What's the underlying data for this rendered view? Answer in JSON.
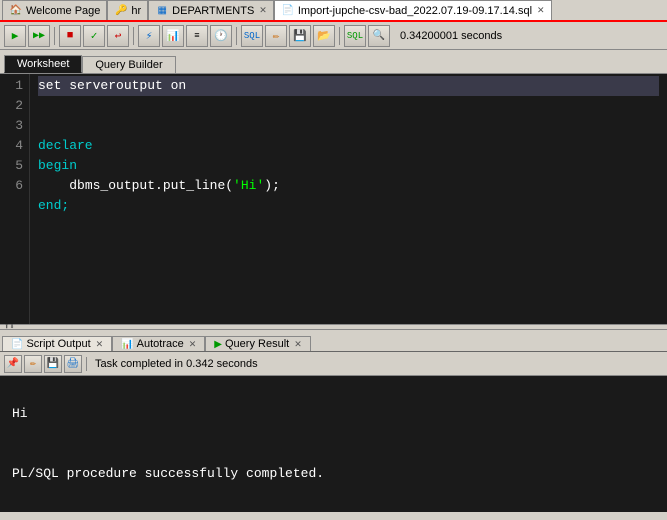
{
  "tabs": [
    {
      "label": "Welcome Page",
      "icon": "🏠",
      "active": false,
      "closable": false
    },
    {
      "label": "hr",
      "icon": "🔑",
      "active": false,
      "closable": false
    },
    {
      "label": "DEPARTMENTS",
      "icon": "📋",
      "active": false,
      "closable": true
    },
    {
      "label": "Import-jupche-csv-bad_2022.07.19-09.17.14.sql",
      "icon": "📄",
      "active": true,
      "closable": true
    }
  ],
  "toolbar": {
    "timer": "0.34200001 seconds"
  },
  "sub_tabs": [
    {
      "label": "Worksheet",
      "active": true
    },
    {
      "label": "Query Builder",
      "active": false
    }
  ],
  "editor": {
    "lines": [
      {
        "num": 1,
        "content": "set serveroutput on",
        "highlight": true
      },
      {
        "num": 2,
        "content": ""
      },
      {
        "num": 3,
        "content": "declare"
      },
      {
        "num": 4,
        "content": "begin"
      },
      {
        "num": 5,
        "content": "    dbms_output.put_line('Hi');"
      },
      {
        "num": 6,
        "content": "end;"
      }
    ]
  },
  "bottom_tabs": [
    {
      "label": "Script Output",
      "icon": "📄",
      "active": true,
      "closable": true
    },
    {
      "label": "Autotrace",
      "icon": "📊",
      "active": false,
      "closable": true
    },
    {
      "label": "Query Result",
      "icon": "▶",
      "active": false,
      "closable": true
    }
  ],
  "bottom_toolbar": {
    "status": "Task completed in 0.342 seconds"
  },
  "output": {
    "lines": [
      "Hi",
      "",
      "",
      "PL/SQL procedure successfully completed."
    ]
  }
}
